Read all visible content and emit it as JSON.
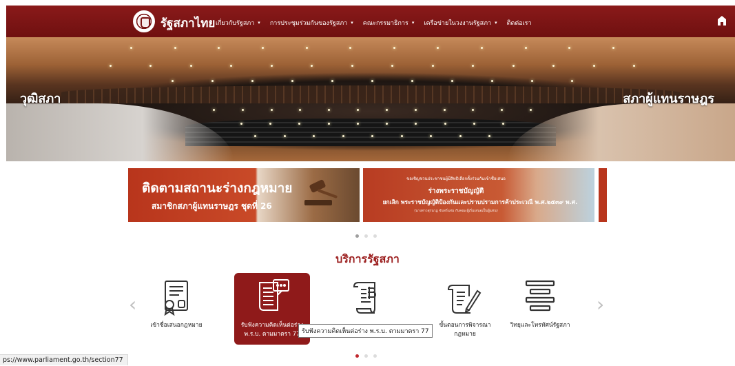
{
  "nav": {
    "brand": "รัฐสภาไทย",
    "menu": [
      {
        "label": "เกี่ยวกับรัฐสภา",
        "has_caret": true
      },
      {
        "label": "การประชุมร่วมกันของรัฐสภา",
        "has_caret": true
      },
      {
        "label": "คณะกรรมาธิการ",
        "has_caret": true
      },
      {
        "label": "เครือข่ายในวงงานรัฐสภา",
        "has_caret": true
      },
      {
        "label": "ติดต่อเรา",
        "has_caret": false
      }
    ],
    "caret": "▾",
    "home_icon": "home-icon"
  },
  "hero": {
    "left_label": "วุฒิสภา",
    "right_label": "สภาผู้แทนราษฎร"
  },
  "promo": {
    "banner1": {
      "title": "ติดตามสถานะร่างกฎหมาย",
      "subtitle": "สมาชิกสภาผู้แทนราษฎร ชุดที่ 26"
    },
    "banner2": {
      "line1": "ขอเชิญชวนประชาชนผู้มีสิทธิเลือกตั้งร่วมกันเข้าชื่อเสนอ",
      "line2": "ร่างพระราชบัญญัติ",
      "line3": "ยกเลิก พระราชบัญญัติป้องกันและปราบปรามการค้าประเวณี พ.ศ.๒๕๓๙ พ.ศ.",
      "line4": "(นางสาวสุรนาฏ จันทร์แจ่ม กับคณะผู้เริ่มเสนอเป็นผู้แทน)"
    }
  },
  "services": {
    "title": "บริการรัฐสภา",
    "items": [
      {
        "label1": "เข้าชื่อเสนอกฎหมาย",
        "label2": "",
        "icon": "document-certificate-icon"
      },
      {
        "label1": "รับฟังความคิดเห็นต่อร่าง",
        "label2": "พ.ร.บ. ตามมาตรา 77",
        "icon": "document-chat-icon"
      },
      {
        "label1": "",
        "label2": "",
        "icon": "scroll-baht-icon"
      },
      {
        "label1": "ขั้นตอนการพิจารณา",
        "label2": "กฎหมาย",
        "icon": "scroll-pen-icon"
      },
      {
        "label1": "วิทยุและโทรทัศน์รัฐสภา",
        "label2": "",
        "icon": "broadcast-bars-icon"
      }
    ],
    "prev": "‹",
    "next": "›"
  },
  "tooltip": "รับฟังความคิดเห็นต่อร่าง พ.ร.บ. ตามมาตรา 77",
  "status_url": "ps://www.parliament.go.th/section77",
  "colors": {
    "nav_bg": "#7a1313",
    "accent": "#9a1b1b",
    "active_card": "#8f1a1a"
  }
}
